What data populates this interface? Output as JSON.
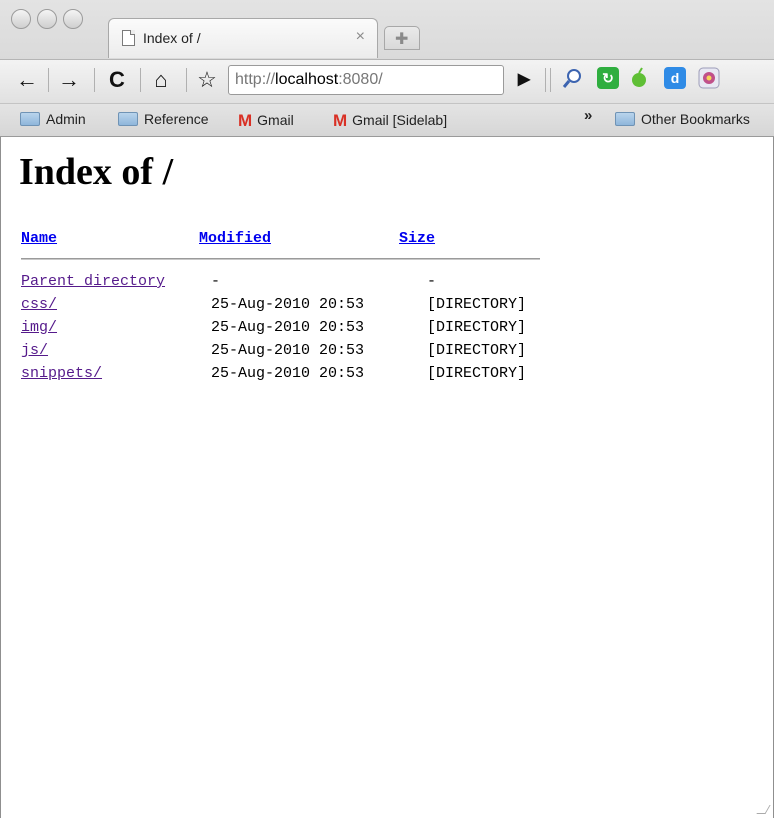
{
  "browser": {
    "tab": {
      "title": "Index of /",
      "close_glyph": "×"
    },
    "newtab_glyph": "✚",
    "toolbar": {
      "back_glyph": "←",
      "forward_glyph": "→",
      "reload_glyph": "C",
      "home_glyph": "⌂",
      "star_glyph": "☆",
      "go_glyph": "▶",
      "url_scheme": "http://",
      "url_host": "localhost",
      "url_rest": ":8080/"
    },
    "bookmarks": {
      "items": [
        "Admin",
        "Reference",
        "Gmail",
        "Gmail [Sidelab]"
      ],
      "chevron": "»",
      "other": "Other Bookmarks"
    },
    "colors": {
      "ext_search": "#d8d8d8",
      "ext_green": "#2fae3f",
      "ext_green2": "#5fbf35",
      "ext_blue": "#2f8be6",
      "ext_gear": "#c0508a"
    }
  },
  "page": {
    "title": "Index of /",
    "headers": {
      "name": "Name",
      "modified": "Modified",
      "size": "Size"
    },
    "rows": [
      {
        "name": "Parent directory",
        "modified": "-",
        "size": "-"
      },
      {
        "name": "css/",
        "modified": "25-Aug-2010 20:53",
        "size": "[DIRECTORY]"
      },
      {
        "name": "img/",
        "modified": "25-Aug-2010 20:53",
        "size": "[DIRECTORY]"
      },
      {
        "name": "js/",
        "modified": "25-Aug-2010 20:53",
        "size": "[DIRECTORY]"
      },
      {
        "name": "snippets/",
        "modified": "25-Aug-2010 20:53",
        "size": "[DIRECTORY]"
      }
    ]
  }
}
